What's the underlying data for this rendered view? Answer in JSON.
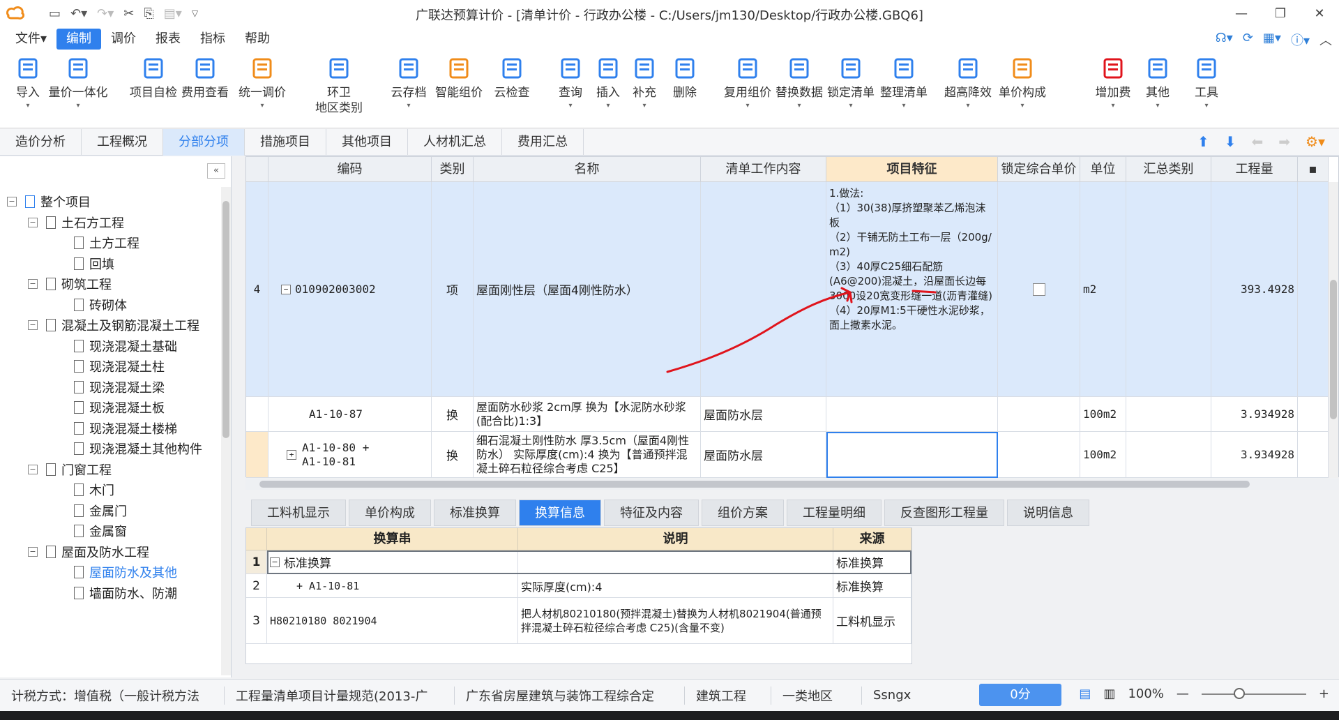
{
  "window": {
    "title": "广联达预算计价 - [清单计价 - 行政办公楼 - C:/Users/jm130/Desktop/行政办公楼.GBQ6]"
  },
  "menu": {
    "items": [
      "文件▾",
      "编制",
      "调价",
      "报表",
      "指标",
      "帮助"
    ],
    "active": "编制"
  },
  "ribbon": {
    "buttons": [
      {
        "label": "导入",
        "icon": "import-icon"
      },
      {
        "label": "量价一体化",
        "icon": "quantity-price-icon"
      },
      {
        "label": "项目自检",
        "icon": "self-check-icon"
      },
      {
        "label": "费用查看",
        "icon": "fee-view-icon"
      },
      {
        "label": "统一调价",
        "icon": "unified-price-icon"
      },
      {
        "label": "环卫\n地区类别",
        "icon": "region-category-icon"
      },
      {
        "label": "云存档",
        "icon": "cloud-archive-icon"
      },
      {
        "label": "智能组价",
        "icon": "smart-pricing-icon"
      },
      {
        "label": "云检查",
        "icon": "cloud-check-icon"
      },
      {
        "label": "查询",
        "icon": "query-icon"
      },
      {
        "label": "插入",
        "icon": "insert-icon"
      },
      {
        "label": "补充",
        "icon": "supplement-icon"
      },
      {
        "label": "删除",
        "icon": "delete-icon"
      },
      {
        "label": "复用组价",
        "icon": "reuse-pricing-icon"
      },
      {
        "label": "替换数据",
        "icon": "replace-data-icon"
      },
      {
        "label": "锁定清单",
        "icon": "lock-list-icon"
      },
      {
        "label": "整理清单",
        "icon": "organize-list-icon"
      },
      {
        "label": "超高降效",
        "icon": "high-rise-icon"
      },
      {
        "label": "单价构成",
        "icon": "unit-price-icon"
      },
      {
        "label": "增加费",
        "icon": "add-fee-icon"
      },
      {
        "label": "其他",
        "icon": "other-icon"
      },
      {
        "label": "工具",
        "icon": "tools-icon"
      }
    ]
  },
  "main_tabs": {
    "items": [
      "造价分析",
      "工程概况",
      "分部分项",
      "措施项目",
      "其他项目",
      "人材机汇总",
      "费用汇总"
    ],
    "active": "分部分项"
  },
  "tree": {
    "nodes": [
      {
        "label": "整个项目",
        "level": 0,
        "pm": "−"
      },
      {
        "label": "土石方工程",
        "level": 1,
        "pm": "−"
      },
      {
        "label": "土方工程",
        "level": 2
      },
      {
        "label": "回填",
        "level": 2
      },
      {
        "label": "砌筑工程",
        "level": 1,
        "pm": "−"
      },
      {
        "label": "砖砌体",
        "level": 2
      },
      {
        "label": "混凝土及钢筋混凝土工程",
        "level": 1,
        "pm": "−"
      },
      {
        "label": "现浇混凝土基础",
        "level": 2
      },
      {
        "label": "现浇混凝土柱",
        "level": 2
      },
      {
        "label": "现浇混凝土梁",
        "level": 2
      },
      {
        "label": "现浇混凝土板",
        "level": 2
      },
      {
        "label": "现浇混凝土楼梯",
        "level": 2
      },
      {
        "label": "现浇混凝土其他构件",
        "level": 2
      },
      {
        "label": "门窗工程",
        "level": 1,
        "pm": "−"
      },
      {
        "label": "木门",
        "level": 2
      },
      {
        "label": "金属门",
        "level": 2
      },
      {
        "label": "金属窗",
        "level": 2
      },
      {
        "label": "屋面及防水工程",
        "level": 1,
        "pm": "−"
      },
      {
        "label": "屋面防水及其他",
        "level": 2,
        "selected": true
      },
      {
        "label": "墙面防水、防潮",
        "level": 2
      }
    ]
  },
  "grid": {
    "headers": [
      "编码",
      "类别",
      "名称",
      "清单工作内容",
      "项目特征",
      "锁定综合单价",
      "单位",
      "汇总类别",
      "工程量"
    ],
    "rows": [
      {
        "num": "4",
        "code": "010902003002",
        "type": "项",
        "name": "屋面刚性层（屋面4刚性防水）",
        "work": "",
        "feature": "1.做法:\n（1）30(38)厚挤塑聚苯乙烯泡沫板\n（2）干铺无防土工布一层（200g/ m2)\n（3）40厚C25细石配筋(A6@200)混凝土，沿屋面长边每3000设20宽变形缝一道(沥青灌缝)\n（4）20厚M1:5干硬性水泥砂浆，面上撒素水泥。",
        "unit": "m2",
        "qty": "393.4928"
      },
      {
        "num": "",
        "code": "A1-10-87",
        "type": "换",
        "name": "屋面防水砂浆 2cm厚  换为【水泥防水砂浆(配合比)1:3】",
        "work": "屋面防水层",
        "feature": "",
        "unit": "100m2",
        "qty": "3.934928"
      },
      {
        "num": "",
        "code": "A1-10-80 +\nA1-10-81",
        "type": "换",
        "name": "细石混凝土刚性防水 厚3.5cm（屋面4刚性防水）  实际厚度(cm):4  换为【普通预拌混凝土碎石粒径综合考虑 C25】",
        "work": "屋面防水层",
        "feature": "",
        "unit": "100m2",
        "qty": "3.934928"
      }
    ]
  },
  "bottom_tabs": {
    "items": [
      "工料机显示",
      "单价构成",
      "标准换算",
      "换算信息",
      "特征及内容",
      "组价方案",
      "工程量明细",
      "反查图形工程量",
      "说明信息"
    ],
    "active": "换算信息"
  },
  "conversion": {
    "headers": [
      "换算串",
      "说明",
      "来源"
    ],
    "rows": [
      {
        "num": "1",
        "string": "标准换算",
        "desc": "",
        "source": "标准换算"
      },
      {
        "num": "2",
        "string": "+ A1-10-81",
        "desc": "实际厚度(cm):4",
        "source": "标准换算"
      },
      {
        "num": "3",
        "string": "H80210180 8021904",
        "desc": "把人材机80210180(预拌混凝土)替换为人材机8021904(普通预拌混凝土碎石粒径综合考虑 C25)(含量不变)",
        "source": "工料机显示"
      }
    ]
  },
  "status": {
    "tax": "计税方式：增值税（一般计税方法",
    "spec": "工程量清单项目计量规范(2013-广",
    "quota": "广东省房屋建筑与装饰工程综合定",
    "project_type": "建筑工程",
    "region": "一类地区",
    "user": "Ssngx",
    "score": "0分",
    "zoom": "100%"
  },
  "colors": {
    "accent": "#2f80ed",
    "annotation": "#e0141c",
    "selected_row": "#dbe9fb",
    "feature_header": "#fde9c9"
  }
}
